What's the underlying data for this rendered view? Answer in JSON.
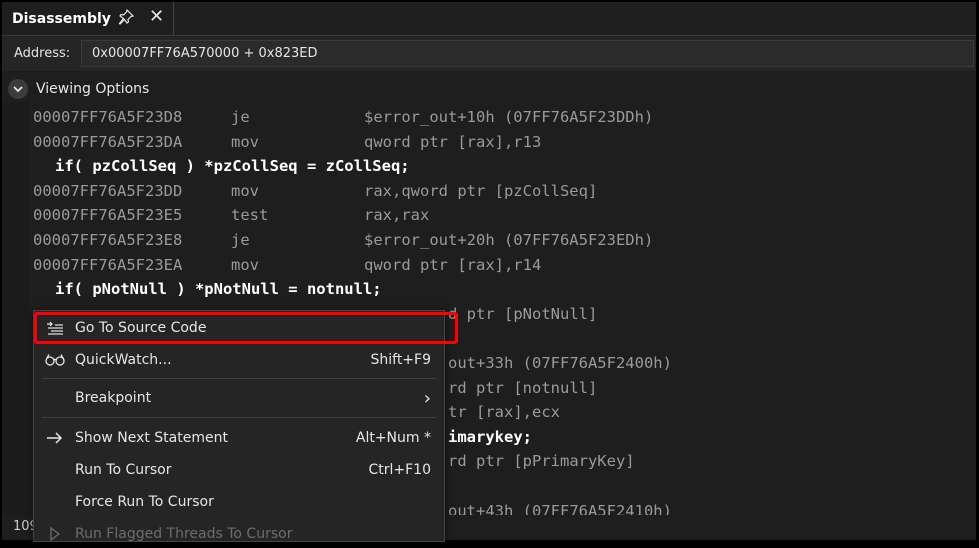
{
  "tab": {
    "title": "Disassembly"
  },
  "address": {
    "label": "Address:",
    "value": "0x00007FF76A570000 + 0x823ED"
  },
  "viewing_options": {
    "label": "Viewing Options"
  },
  "code_lines": [
    {
      "kind": "asm",
      "addr": "00007FF76A5F23D8",
      "mnemonic": "je",
      "operands": "$error_out+10h (07FF76A5F23DDh)"
    },
    {
      "kind": "asm",
      "addr": "00007FF76A5F23DA",
      "mnemonic": "mov",
      "operands": "qword ptr [rax],r13"
    },
    {
      "kind": "src",
      "text": "if( pzCollSeq ) *pzCollSeq = zCollSeq;"
    },
    {
      "kind": "asm",
      "addr": "00007FF76A5F23DD",
      "mnemonic": "mov",
      "operands": "rax,qword ptr [pzCollSeq]"
    },
    {
      "kind": "asm",
      "addr": "00007FF76A5F23E5",
      "mnemonic": "test",
      "operands": "rax,rax"
    },
    {
      "kind": "asm",
      "addr": "00007FF76A5F23E8",
      "mnemonic": "je",
      "operands": "$error_out+20h (07FF76A5F23EDh)"
    },
    {
      "kind": "asm",
      "addr": "00007FF76A5F23EA",
      "mnemonic": "mov",
      "operands": "qword ptr [rax],r14"
    },
    {
      "kind": "src",
      "text": "if( pNotNull ) *pNotNull = notnull;"
    },
    {
      "kind": "partial",
      "text": "d ptr [pNotNull]"
    },
    {
      "kind": "partial",
      "text": ""
    },
    {
      "kind": "partial",
      "text": "out+33h (07FF76A5F2400h)"
    },
    {
      "kind": "partial",
      "text": "rd ptr [notnull]"
    },
    {
      "kind": "partial",
      "text": "tr [rax],ecx"
    },
    {
      "kind": "partial_src",
      "text": "imarykey;"
    },
    {
      "kind": "partial",
      "text": "rd ptr [pPrimaryKey]"
    },
    {
      "kind": "partial",
      "text": ""
    },
    {
      "kind": "partial",
      "text": "out+43h (07FF76A5F2410h)"
    }
  ],
  "zoom": "109",
  "context_menu": {
    "items": [
      {
        "label": "Go To Source Code",
        "shortcut": "",
        "icon": "go-to-source-icon"
      },
      {
        "label": "QuickWatch...",
        "shortcut": "Shift+F9",
        "icon": "glasses-icon"
      },
      {
        "label": "Breakpoint",
        "shortcut": "",
        "icon": ""
      },
      {
        "label": "Show Next Statement",
        "shortcut": "Alt+Num *",
        "icon": "arrow-right-icon"
      },
      {
        "label": "Run To Cursor",
        "shortcut": "Ctrl+F10",
        "icon": ""
      },
      {
        "label": "Force Run To Cursor",
        "shortcut": "",
        "icon": ""
      },
      {
        "label": "Run Flagged Threads To Cursor",
        "shortcut": "",
        "icon": "flag-run-icon"
      }
    ],
    "submenu_arrow": "›"
  }
}
